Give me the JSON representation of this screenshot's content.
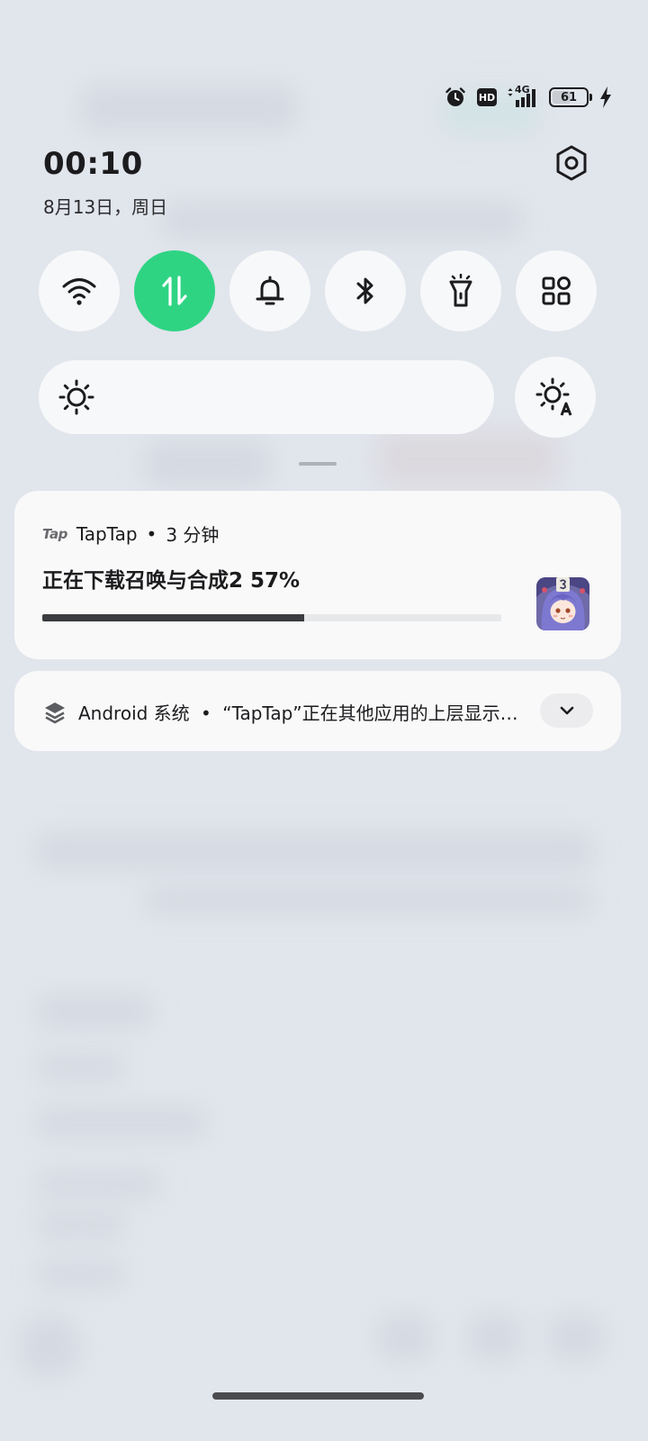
{
  "status_bar": {
    "network": "4G",
    "hd_badge": "HD",
    "battery": "61",
    "battery_level": 0.61
  },
  "header": {
    "time": "00:10",
    "date": "8月13日，周日"
  },
  "quick_tiles": [
    {
      "name": "wifi",
      "icon": "wifi-icon",
      "active": false
    },
    {
      "name": "mobile-data",
      "icon": "data-transfer-icon",
      "active": true
    },
    {
      "name": "sound",
      "icon": "bell-icon",
      "active": false
    },
    {
      "name": "bluetooth",
      "icon": "bluetooth-icon",
      "active": false
    },
    {
      "name": "flashlight",
      "icon": "flashlight-icon",
      "active": false
    },
    {
      "name": "more-tiles",
      "icon": "grid-icon",
      "active": false
    }
  ],
  "colors": {
    "active_tile": "#2fd483",
    "background": "#e1e5ec",
    "card": "#f9f9fa"
  },
  "notifications": [
    {
      "app_logo": "Tap",
      "app_name": "TapTap",
      "separator": "•",
      "time_ago": "3 分钟",
      "title": "正在下载召唤与合成2 57%",
      "progress": 0.57
    },
    {
      "app_name": "Android 系统",
      "separator": "•",
      "text": "“TapTap”正在其他应用的上层显示内容"
    }
  ]
}
